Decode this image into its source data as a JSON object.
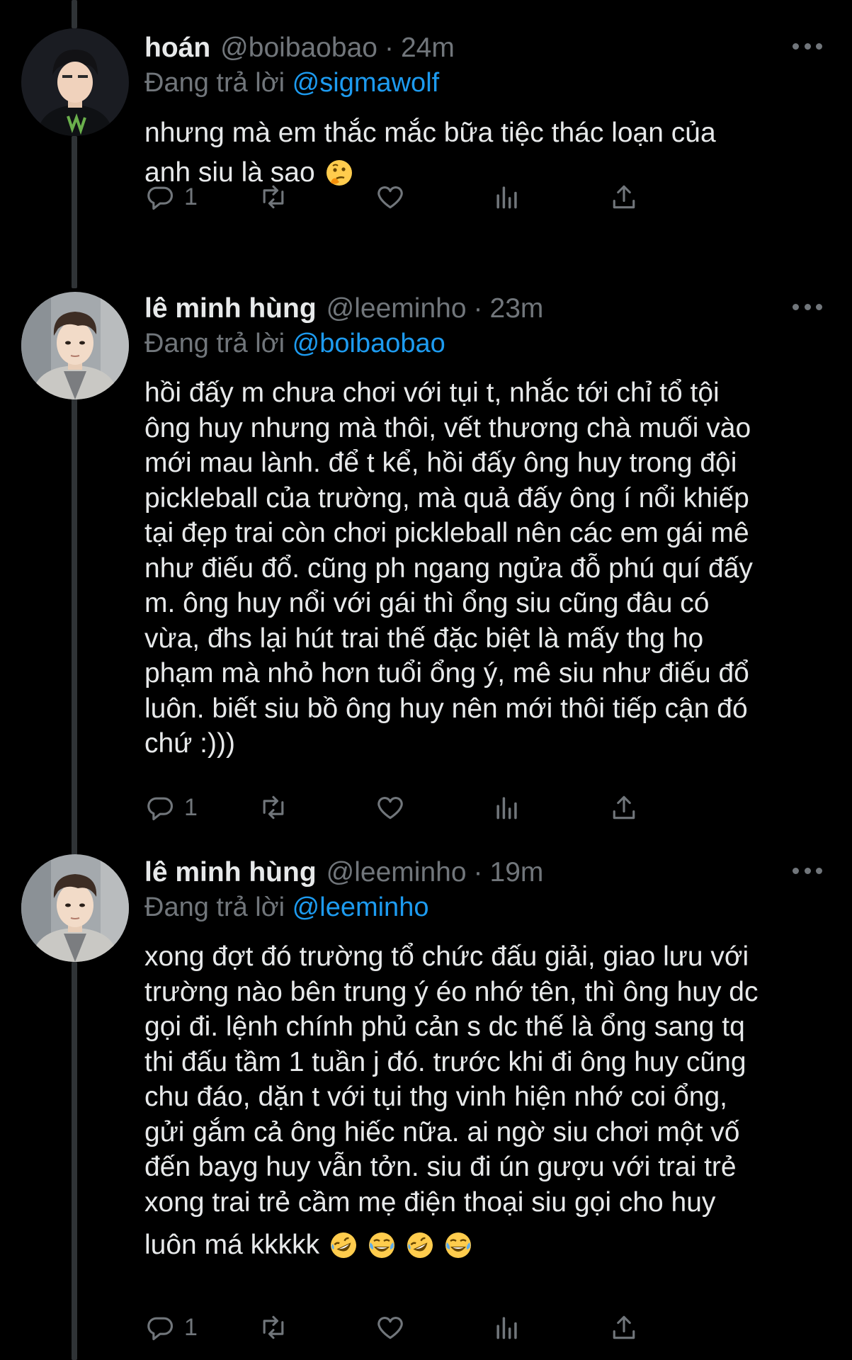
{
  "colors": {
    "background": "#000000",
    "text": "#e7e9ea",
    "muted": "#71767b",
    "accent": "#1d9bf0",
    "thread_line": "#2f3336"
  },
  "tweets": [
    {
      "name": "hoán",
      "handle": "@boibaobao",
      "separator": "·",
      "time": "24m",
      "reply_prefix": "Đang trả lời",
      "reply_to": "@sigmawolf",
      "text_lines": "nhưng mà em thắc mắc bữa tiệc thác loạn của",
      "last_line": "anh siu là sao",
      "emojis": [
        "thinking-face-emoji"
      ],
      "reply_count": "1",
      "icons": [
        "reply-icon",
        "retweet-icon",
        "like-icon",
        "views-icon",
        "share-icon",
        "more-icon"
      ]
    },
    {
      "name": "lê minh hùng",
      "handle": "@leeminho",
      "separator": "·",
      "time": "23m",
      "reply_prefix": "Đang trả lời",
      "reply_to": "@boibaobao",
      "text_lines": "hồi đấy m chưa chơi với tụi t, nhắc tới chỉ tổ tội\nông huy nhưng mà thôi, vết thương chà muối vào\nmới mau lành. để t kể, hồi đấy ông huy trong đội\npickleball của trường, mà quả đấy ông í nổi khiếp\ntại đẹp trai còn chơi pickleball nên các em gái mê\nnhư điếu đổ. cũng ph ngang ngửa đỗ phú quí đấy\nm. ông huy nổi với gái thì ổng siu cũng đâu có\nvừa, đhs lại hút trai thế đặc biệt là mấy thg họ\nphạm mà nhỏ hơn tuổi ổng ý, mê siu như điếu đổ\nluôn. biết siu bồ ông huy nên mới thôi tiếp cận đó\nchứ :)))",
      "reply_count": "1"
    },
    {
      "name": "lê minh hùng",
      "handle": "@leeminho",
      "separator": "·",
      "time": "19m",
      "reply_prefix": "Đang trả lời",
      "reply_to": "@leeminho",
      "text_lines": "xong đợt đó trường tổ chức đấu giải, giao lưu với\ntrường nào bên trung ý éo nhớ tên, thì ông huy dc\ngọi đi. lệnh chính phủ cản s dc thế là ổng sang tq\nthi đấu tầm 1 tuần j đó. trước khi đi ông huy cũng\nchu đáo, dặn t với tụi thg vinh hiện nhớ coi ổng,\ngửi gắm cả ông hiếc nữa. ai ngờ siu chơi một vố\nđến bayg huy vẫn tởn. siu đi ún gượu với trai trẻ\nxong trai trẻ cầm mẹ điện thoại siu gọi cho huy",
      "last_line": "luôn má kkkkk",
      "emojis": [
        "rofl-emoji",
        "joy-emoji",
        "rofl-emoji",
        "joy-emoji"
      ],
      "reply_count": "1"
    }
  ]
}
